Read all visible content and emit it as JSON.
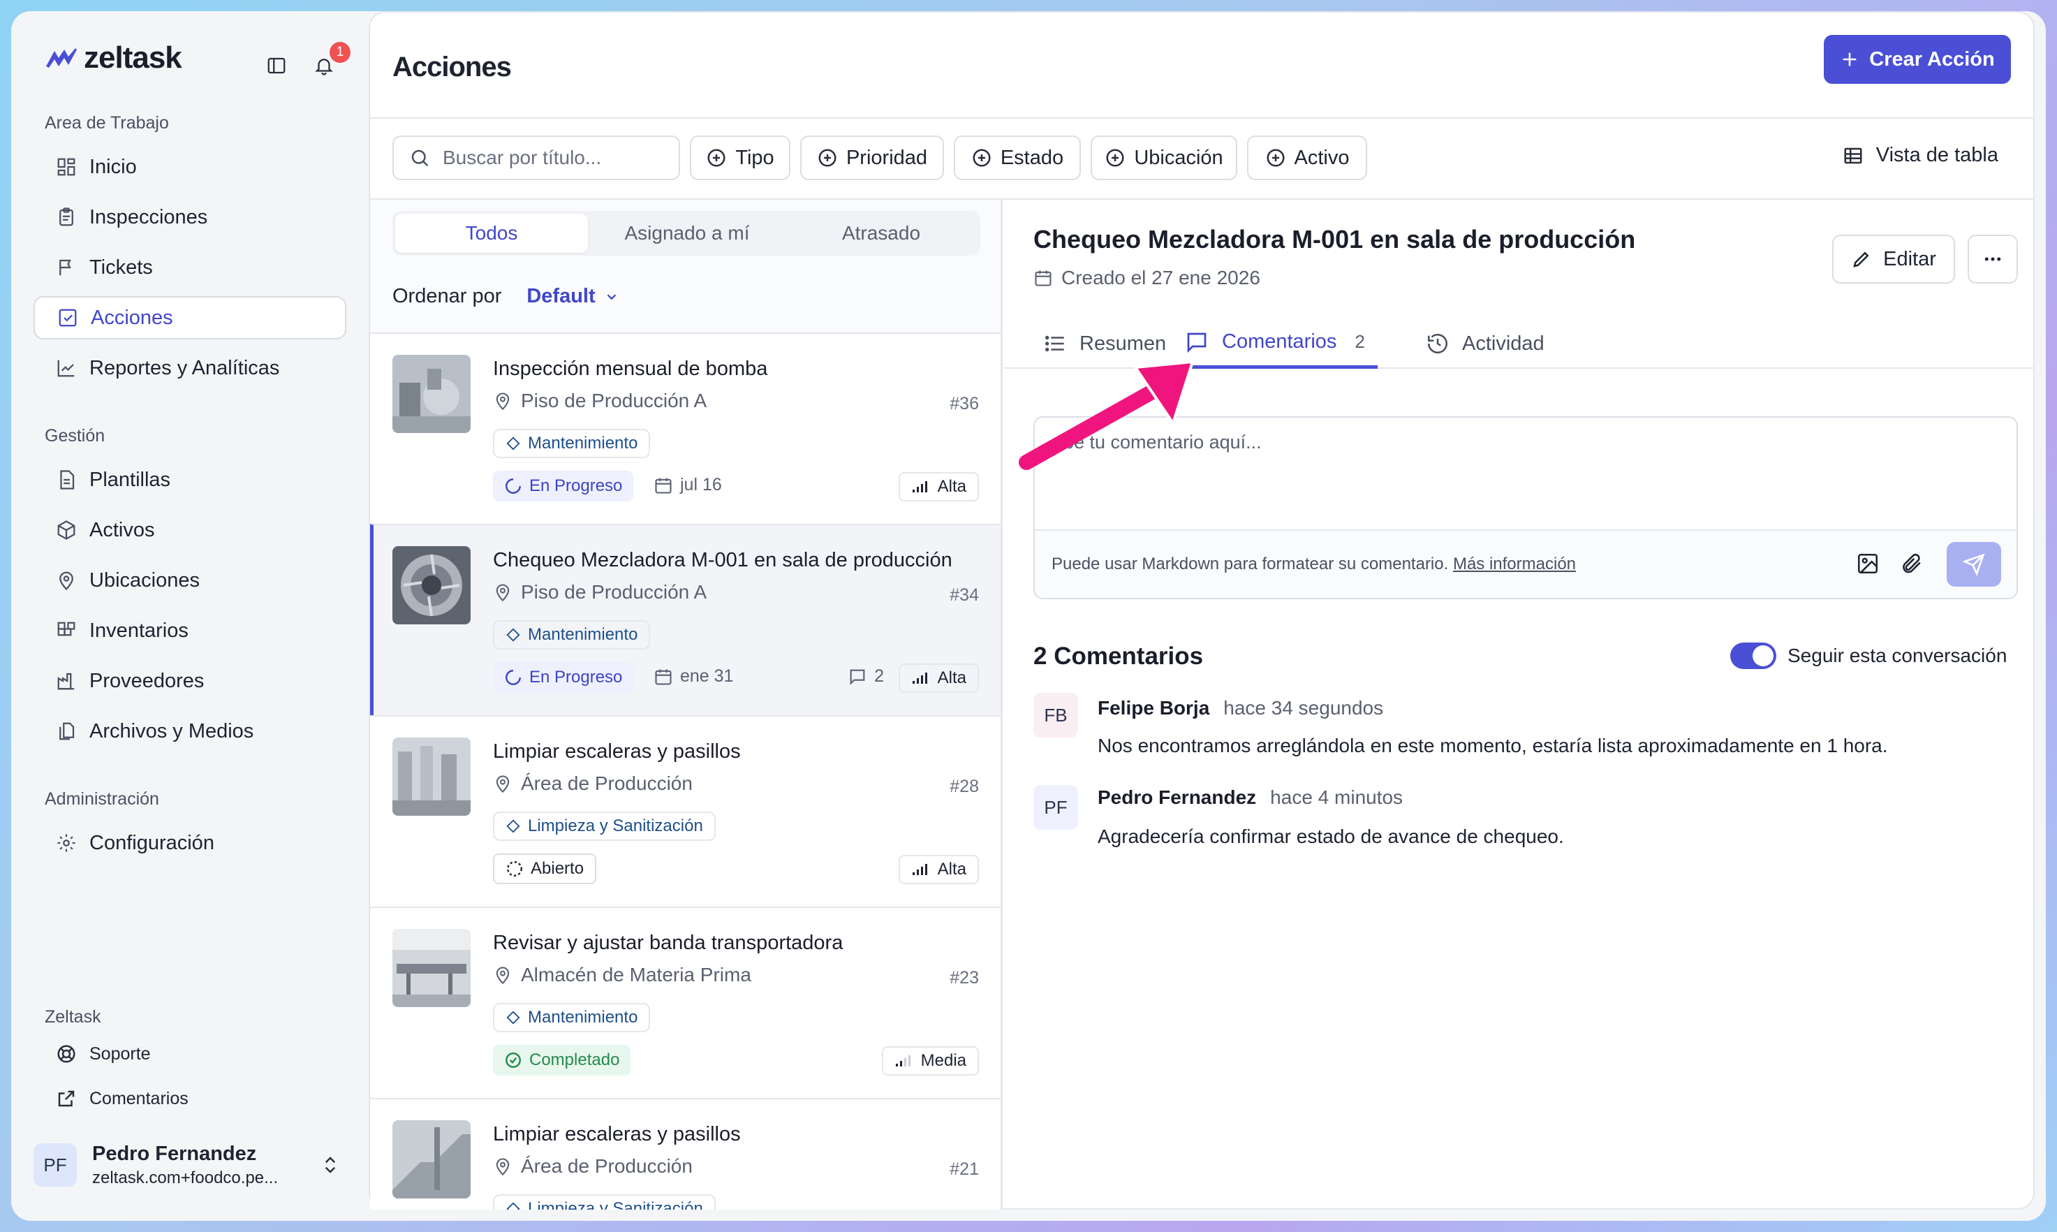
{
  "app": {
    "logo_text": "zeltask",
    "notification_count": "1"
  },
  "sidebar": {
    "sections": [
      {
        "title": "Area de Trabajo",
        "items": [
          "Inicio",
          "Inspecciones",
          "Tickets",
          "Acciones",
          "Reportes y Analíticas"
        ]
      },
      {
        "title": "Gestión",
        "items": [
          "Plantillas",
          "Activos",
          "Ubicaciones",
          "Inventarios",
          "Proveedores",
          "Archivos y Medios"
        ]
      },
      {
        "title": "Administración",
        "items": [
          "Configuración"
        ]
      },
      {
        "title": "Zeltask",
        "items": [
          "Soporte",
          "Comentarios"
        ]
      }
    ],
    "active_item": "Acciones",
    "user": {
      "initials": "PF",
      "name": "Pedro Fernandez",
      "email": "zeltask.com+foodco.pe..."
    }
  },
  "header": {
    "title": "Acciones",
    "create_button": "Crear Acción"
  },
  "filters": {
    "search_placeholder": "Buscar por título...",
    "chips": [
      "Tipo",
      "Prioridad",
      "Estado",
      "Ubicación",
      "Activo"
    ],
    "table_view": "Vista de tabla"
  },
  "list": {
    "tabs": [
      "Todos",
      "Asignado a mí",
      "Atrasado"
    ],
    "active_tab": "Todos",
    "sort_label": "Ordenar por",
    "sort_value": "Default",
    "items": [
      {
        "title": "Inspección mensual de bomba",
        "location": "Piso de Producción A",
        "number": "#36",
        "tag": "Mantenimiento",
        "status": "En Progreso",
        "date": "jul 16",
        "comments": "",
        "priority": "Alta"
      },
      {
        "title": "Chequeo Mezcladora M-001 en sala de producción",
        "location": "Piso de Producción A",
        "number": "#34",
        "tag": "Mantenimiento",
        "status": "En Progreso",
        "date": "ene 31",
        "comments": "2",
        "priority": "Alta"
      },
      {
        "title": "Limpiar escaleras y pasillos",
        "location": "Área de Producción",
        "number": "#28",
        "tag": "Limpieza y Sanitización",
        "status": "Abierto",
        "date": "",
        "comments": "",
        "priority": "Alta"
      },
      {
        "title": "Revisar y ajustar banda transportadora",
        "location": "Almacén de Materia Prima",
        "number": "#23",
        "tag": "Mantenimiento",
        "status": "Completado",
        "date": "",
        "comments": "",
        "priority": "Media"
      },
      {
        "title": "Limpiar escaleras y pasillos",
        "location": "Área de Producción",
        "number": "#21",
        "tag": "Limpieza y Sanitización",
        "status": "",
        "date": "",
        "comments": "",
        "priority": ""
      }
    ]
  },
  "detail": {
    "title": "Chequeo Mezcladora M-001 en sala de producción",
    "created": "Creado el 27 ene 2026",
    "edit_button": "Editar",
    "tabs": [
      {
        "label": "Resumen",
        "count": ""
      },
      {
        "label": "Comentarios",
        "count": "2"
      },
      {
        "label": "Actividad",
        "count": ""
      }
    ],
    "active_tab": "Comentarios",
    "editor": {
      "placeholder": "ribe tu comentario aquí...",
      "hint": "Puede usar Markdown para formatear su comentario.",
      "hint_link": "Más información"
    },
    "comments_title": "2 Comentarios",
    "follow_label": "Seguir esta conversación",
    "follow_on": true,
    "comments": [
      {
        "initials": "FB",
        "author": "Felipe Borja",
        "time": "hace 34 segundos",
        "text": "Nos encontramos arreglándola en este momento, estaría lista aproximadamente en 1 hora."
      },
      {
        "initials": "PF",
        "author": "Pedro Fernandez",
        "time": "hace 4 minutos",
        "text": "Agradecería confirmar estado de avance de chequeo."
      }
    ]
  },
  "colors": {
    "accent": "#4a4fd6",
    "annotation_arrow": "#f0157e",
    "notification": "#f05252"
  }
}
